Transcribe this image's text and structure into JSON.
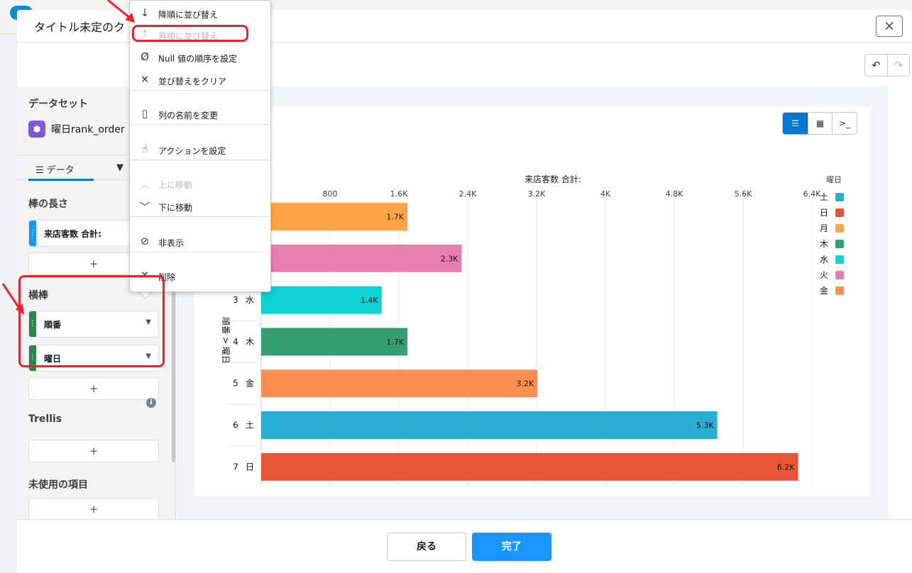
{
  "modal": {
    "title": "タイトル未定のク",
    "close_icon": "×"
  },
  "left_panel": {
    "dataset_heading": "データセット",
    "dataset_name": "曜日rank_order",
    "tab_data": "データ",
    "bar_length_heading": "棒の長さ",
    "bar_length_field": "来店客数 合計:",
    "grouping_heading": "横棒",
    "group_fields": [
      "順番",
      "曜日"
    ],
    "trellis_heading": "Trellis",
    "unused_heading": "未使用の項目",
    "add_label": "+"
  },
  "context_menu": {
    "items": [
      {
        "label": "降順に並び替え",
        "icon": "↓",
        "disabled": false
      },
      {
        "label": "昇順に並び替え",
        "icon": "↑",
        "disabled": true
      },
      {
        "label": "Null 値の順序を設定",
        "icon": "Ø",
        "disabled": false
      },
      {
        "label": "並び替えをクリア",
        "icon": "✕",
        "disabled": false
      },
      {
        "label": "列の名前を変更",
        "icon": "▯",
        "disabled": false
      },
      {
        "label": "アクションを設定",
        "icon": "☝",
        "disabled": false
      },
      {
        "label": "上に移動",
        "icon": "︿",
        "disabled": true
      },
      {
        "label": "下に移動",
        "icon": "﹀",
        "disabled": false
      },
      {
        "label": "非表示",
        "icon": "⊘",
        "disabled": false
      },
      {
        "label": "削除",
        "icon": "✕",
        "disabled": false
      }
    ]
  },
  "footer": {
    "back_label": "戻る",
    "done_label": "完了"
  },
  "colors": {
    "accent": "#0176d3",
    "primary_button": "#1b96ff",
    "annotation_red": "#e8232b"
  },
  "chart_data": {
    "type": "bar",
    "orientation": "horizontal",
    "title": "",
    "xlabel": "来店客数 合計:",
    "ylabel": "順番 > 曜日",
    "xlim": [
      0,
      6400
    ],
    "x_ticks": [
      800,
      1600,
      2400,
      3200,
      4000,
      4800,
      5600,
      6400
    ],
    "x_tick_labels": [
      "800",
      "1.6K",
      "2.4K",
      "3.2K",
      "4K",
      "4.8K",
      "5.6K",
      "6.4K"
    ],
    "categories": [
      {
        "order": "",
        "day": "",
        "value": 1700,
        "label": "1.7K",
        "color": "#ffa445"
      },
      {
        "order": "",
        "day": "",
        "value": 2330,
        "label": "2.3K",
        "color": "#e67fad"
      },
      {
        "order": "3",
        "day": "水",
        "value": 1400,
        "label": "1.4K",
        "color": "#0ed1d1"
      },
      {
        "order": "4",
        "day": "木",
        "value": 1700,
        "label": "1.7K",
        "color": "#359e72"
      },
      {
        "order": "5",
        "day": "金",
        "value": 3210,
        "label": "3.2K",
        "color": "#ff8e52"
      },
      {
        "order": "6",
        "day": "土",
        "value": 5300,
        "label": "5.3K",
        "color": "#2aadd2"
      },
      {
        "order": "7",
        "day": "日",
        "value": 6240,
        "label": "6.2K",
        "color": "#e85536"
      }
    ],
    "legend": {
      "title": "曜日",
      "placement": "right",
      "items": [
        {
          "name": "土",
          "color": "#2aadd2"
        },
        {
          "name": "日",
          "color": "#e85536"
        },
        {
          "name": "月",
          "color": "#ffa445"
        },
        {
          "name": "木",
          "color": "#359e72"
        },
        {
          "name": "水",
          "color": "#0ed1d1"
        },
        {
          "name": "火",
          "color": "#e67fad"
        },
        {
          "name": "金",
          "color": "#ff8e52"
        }
      ]
    },
    "grid": true
  }
}
